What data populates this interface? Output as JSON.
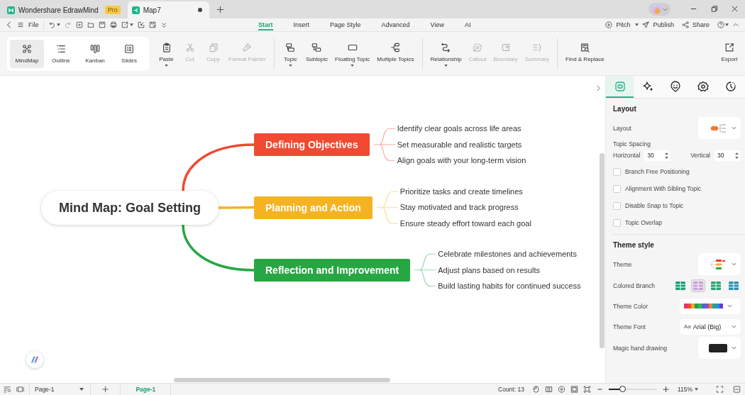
{
  "title_bar": {
    "tabs": [
      {
        "label": "Wondershare EdrawMind",
        "badge": "Pro",
        "selected": false
      },
      {
        "label": "Map7",
        "selected": true
      }
    ]
  },
  "menu_bar": {
    "file": "File",
    "tabs": [
      {
        "label": "Start",
        "selected": true
      },
      {
        "label": "Insert",
        "selected": false
      },
      {
        "label": "Page Style",
        "selected": false
      },
      {
        "label": "Advanced",
        "selected": false
      },
      {
        "label": "View",
        "selected": false
      },
      {
        "label": "AI",
        "selected": false
      }
    ],
    "actions": [
      {
        "label": "Pitch"
      },
      {
        "label": "Publish"
      },
      {
        "label": "Share"
      }
    ]
  },
  "ribbon": {
    "views": [
      {
        "label": "MindMap",
        "selected": true
      },
      {
        "label": "Outline",
        "selected": false
      },
      {
        "label": "Kanban",
        "selected": false
      },
      {
        "label": "Slides",
        "selected": false
      }
    ],
    "groups": [
      {
        "tools": [
          {
            "label": "Paste",
            "disabled": false,
            "dropdown": true
          },
          {
            "label": "Cut",
            "disabled": true,
            "dropdown": false
          },
          {
            "label": "Copy",
            "disabled": true,
            "dropdown": false
          },
          {
            "label": "Format Painter",
            "disabled": true,
            "dropdown": false
          }
        ]
      },
      {
        "tools": [
          {
            "label": "Topic",
            "disabled": false,
            "dropdown": true
          },
          {
            "label": "Subtopic",
            "disabled": false,
            "dropdown": false
          },
          {
            "label": "Floating Topic",
            "disabled": false,
            "dropdown": true
          },
          {
            "label": "Multiple Topics",
            "disabled": false,
            "dropdown": false
          }
        ]
      },
      {
        "tools": [
          {
            "label": "Relationship",
            "disabled": false,
            "dropdown": true
          },
          {
            "label": "Callout",
            "disabled": true,
            "dropdown": false
          },
          {
            "label": "Boundary",
            "disabled": true,
            "dropdown": false
          },
          {
            "label": "Summary",
            "disabled": true,
            "dropdown": false
          }
        ]
      },
      {
        "tools": [
          {
            "label": "Find & Replace",
            "disabled": false,
            "dropdown": false
          }
        ]
      }
    ],
    "export": "Export"
  },
  "mind_map": {
    "central": "Mind Map: Goal Setting",
    "branches": [
      {
        "label": "Defining Objectives",
        "color": "#f04a32",
        "children": [
          {
            "label": "Identify clear goals across life areas"
          },
          {
            "label": "Set measurable and realistic targets"
          },
          {
            "label": "Align goals with your long-term vision"
          }
        ]
      },
      {
        "label": "Planning and Action",
        "color": "#f5b324",
        "children": [
          {
            "label": "Prioritize tasks and create timelines"
          },
          {
            "label": "Stay motivated and track progress"
          },
          {
            "label": "Ensure steady effort toward each goal"
          }
        ]
      },
      {
        "label": "Reflection and Improvement",
        "color": "#27a744",
        "children": [
          {
            "label": "Celebrate milestones and achievements"
          },
          {
            "label": "Adjust plans based on results"
          },
          {
            "label": "Build lasting habits for continued success"
          }
        ]
      }
    ]
  },
  "panel": {
    "tabs": [
      {
        "selected": true
      },
      {
        "selected": false
      },
      {
        "selected": false
      },
      {
        "selected": false
      },
      {
        "selected": false
      }
    ],
    "layout": {
      "heading": "Layout",
      "layout_label": "Layout",
      "spacing_label": "Topic Spacing",
      "horizontal": {
        "label": "Horizontal",
        "value": "30"
      },
      "vertical": {
        "label": "Vertical",
        "value": "30"
      },
      "options": [
        {
          "label": "Branch Free Positioning",
          "checked": false
        },
        {
          "label": "Alignment With Sibling Topic",
          "checked": false
        },
        {
          "label": "Disable Snap to Topic",
          "checked": false
        },
        {
          "label": "Topic Overlap",
          "checked": false
        }
      ]
    },
    "theme_style": {
      "heading": "Theme style",
      "theme_label": "Theme",
      "colored_branch_label": "Colored Branch",
      "branch_styles": [
        {
          "selected": false
        },
        {
          "selected": true
        },
        {
          "selected": false
        },
        {
          "selected": false
        }
      ],
      "theme_color_label": "Theme Color",
      "swatches": [
        {
          "color": "#e8336e"
        },
        {
          "color": "#f04a32"
        },
        {
          "color": "#f5a623"
        },
        {
          "color": "#1e9e57"
        },
        {
          "color": "#3cb44b"
        },
        {
          "color": "#3f6fd8"
        },
        {
          "color": "#8a4fc8"
        },
        {
          "color": "#f08030"
        },
        {
          "color": "#1aa89c"
        },
        {
          "color": "#2a8fd8"
        },
        {
          "color": "#6a3cc8"
        }
      ],
      "theme_font_label": "Theme Font",
      "font_sample": "Aa",
      "theme_font": "Arial (Big)",
      "magic_label": "Magic hand drawing"
    }
  },
  "status_bar": {
    "page_select": "Page-1",
    "pages": [
      {
        "label": "Page-1",
        "selected": true
      }
    ],
    "count": "Count: 13",
    "zoom": {
      "level": 0.3
    },
    "zoom_value": "115%"
  }
}
